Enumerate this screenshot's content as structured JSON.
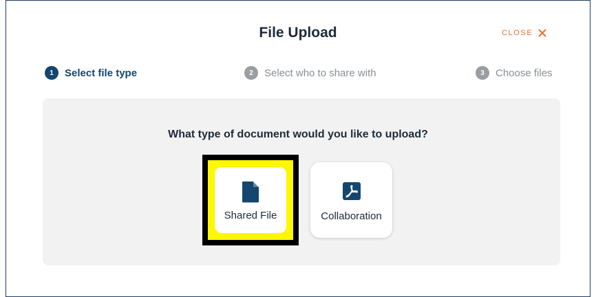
{
  "dialog": {
    "title": "File Upload",
    "close_label": "CLOSE"
  },
  "steps": [
    {
      "number": "1",
      "label": "Select file type",
      "state": "active"
    },
    {
      "number": "2",
      "label": "Select who to share with",
      "state": "inactive"
    },
    {
      "number": "3",
      "label": "Choose files",
      "state": "inactive"
    }
  ],
  "question": "What type of document would you like to upload?",
  "options": [
    {
      "label": "Shared File",
      "icon": "document-icon",
      "highlighted": true
    },
    {
      "label": "Collaboration",
      "icon": "pdf-icon",
      "highlighted": false
    }
  ],
  "colors": {
    "brand": "#14466e",
    "close": "#e8702a",
    "highlight": "#fff700",
    "inactive_step": "#9a9ea3"
  }
}
